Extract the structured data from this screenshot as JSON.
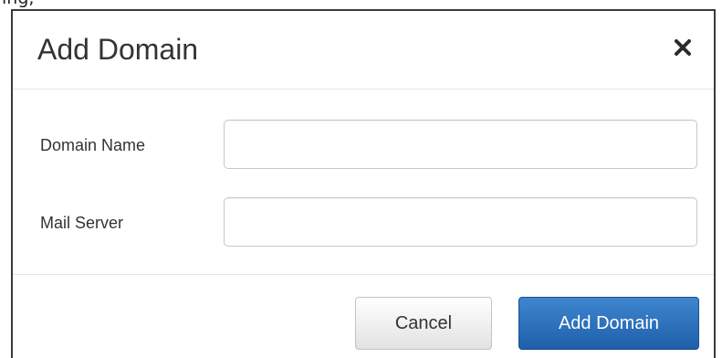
{
  "page": {
    "top_fragment": "ing,"
  },
  "dialog": {
    "title": "Add Domain",
    "close_symbol": "×",
    "close_icon": "close-icon",
    "fields": [
      {
        "label": "Domain Name",
        "value": "",
        "placeholder": ""
      },
      {
        "label": "Mail Server",
        "value": "",
        "placeholder": ""
      }
    ],
    "buttons": {
      "cancel_label": "Cancel",
      "submit_label": "Add Domain"
    },
    "colors": {
      "primary": "#2a6ebb",
      "title_text": "#333333",
      "border": "#3a3a3a"
    }
  }
}
